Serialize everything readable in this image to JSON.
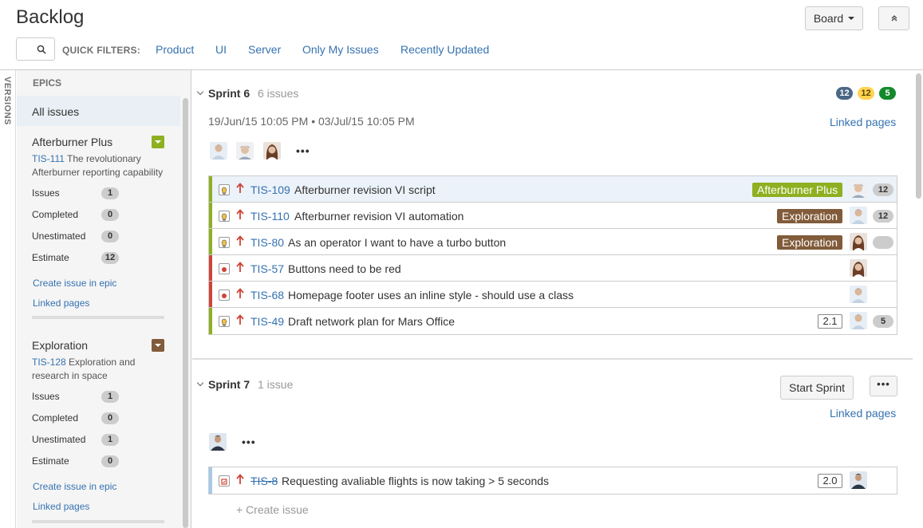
{
  "header": {
    "title": "Backlog",
    "board_label": "Board"
  },
  "quick_filters": {
    "label": "QUICK FILTERS:",
    "items": [
      "Product",
      "UI",
      "Server",
      "Only My Issues",
      "Recently Updated"
    ]
  },
  "sidebar": {
    "versions_label": "VERSIONS",
    "epics_title": "EPICS",
    "all_issues": "All issues",
    "epics": [
      {
        "name": "Afterburner Plus",
        "color": "#8eb021",
        "key": "TIS-111",
        "desc": "The revolutionary Afterburner reporting capability",
        "stats": [
          {
            "label": "Issues",
            "value": "1"
          },
          {
            "label": "Completed",
            "value": "0"
          },
          {
            "label": "Unestimated",
            "value": "0"
          },
          {
            "label": "Estimate",
            "value": "12"
          }
        ],
        "create_link": "Create issue in epic",
        "linked_pages": "Linked pages"
      },
      {
        "name": "Exploration",
        "color": "#815b3a",
        "key": "TIS-128",
        "desc": "Exploration and research in space",
        "stats": [
          {
            "label": "Issues",
            "value": "1"
          },
          {
            "label": "Completed",
            "value": "0"
          },
          {
            "label": "Unestimated",
            "value": "1"
          },
          {
            "label": "Estimate",
            "value": "0"
          }
        ],
        "create_link": "Create issue in epic",
        "linked_pages": "Linked pages"
      }
    ]
  },
  "sprint6": {
    "name": "Sprint 6",
    "count": "6 issues",
    "dates": "19/Jun/15 10:05 PM • 03/Jul/15 10:05 PM",
    "linked_pages": "Linked pages",
    "badges": [
      {
        "value": "12",
        "color": "#4a6785",
        "text_color": "#ffffff"
      },
      {
        "value": "12",
        "color": "#ffd351",
        "text_color": "#594300"
      },
      {
        "value": "5",
        "color": "#14892c",
        "text_color": "#ffffff"
      }
    ],
    "issues": [
      {
        "key": "TIS-109",
        "summary": "Afterburner revision VI script",
        "epic": "Afterburner Plus",
        "epic_color": "#8eb021",
        "estimate": "12",
        "type": "story"
      },
      {
        "key": "TIS-110",
        "summary": "Afterburner revision VI automation",
        "epic": "Exploration",
        "epic_color": "#815b3a",
        "estimate": "12",
        "type": "story"
      },
      {
        "key": "TIS-80",
        "summary": "As an operator I want to have a turbo button",
        "epic": "Exploration",
        "epic_color": "#815b3a",
        "estimate": "",
        "type": "story"
      },
      {
        "key": "TIS-57",
        "summary": "Buttons need to be red",
        "type": "bug"
      },
      {
        "key": "TIS-68",
        "summary": "Homepage footer uses an inline style - should use a class",
        "type": "bug"
      },
      {
        "key": "TIS-49",
        "summary": "Draft network plan for Mars Office",
        "points": "2.1",
        "estimate": "5",
        "type": "story"
      }
    ]
  },
  "sprint7": {
    "name": "Sprint 7",
    "count": "1 issue",
    "start_label": "Start Sprint",
    "linked_pages": "Linked pages",
    "issues": [
      {
        "key": "TIS-8",
        "summary": "Requesting avaliable flights is now taking > 5 seconds",
        "points": "2.0",
        "type": "task"
      }
    ],
    "create_issue": "+ Create issue"
  },
  "colors": {
    "link": "#3572b0",
    "story": "#8eb021",
    "bug": "#d04437",
    "task_bar": "#a5c9ea",
    "priority": "#d04437"
  }
}
